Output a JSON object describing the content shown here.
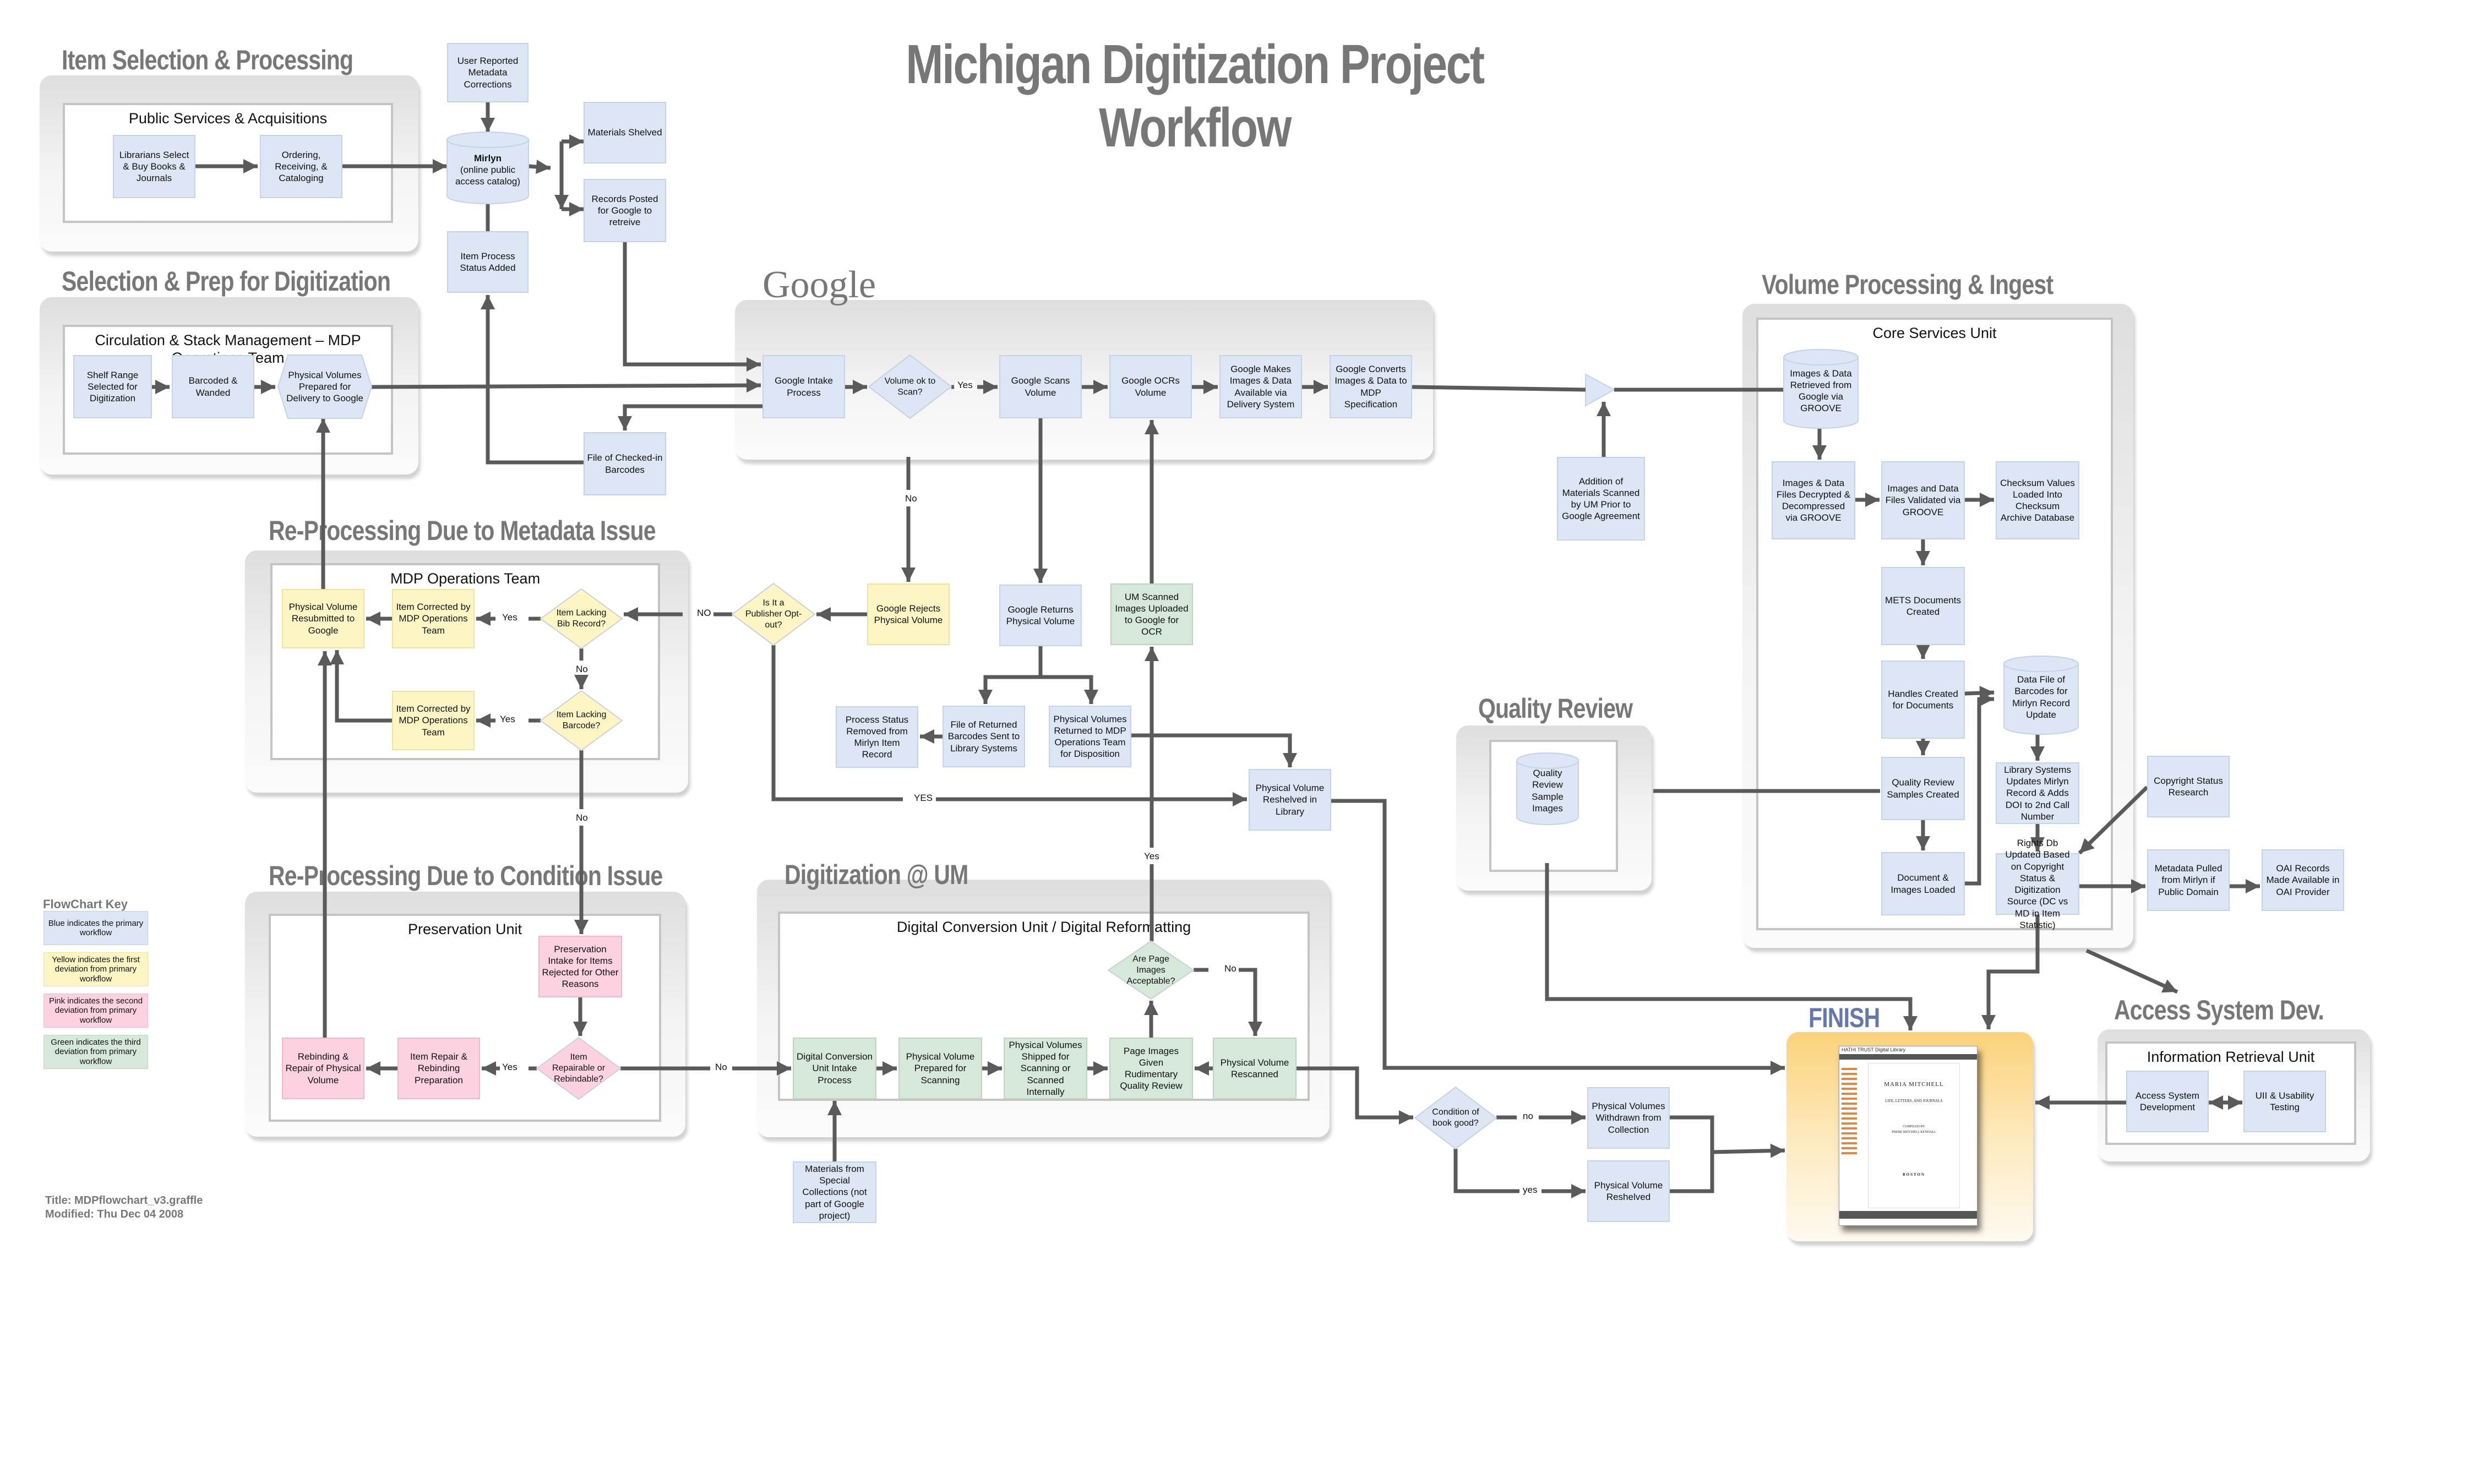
{
  "title": "Michigan Digitization Project Workflow",
  "colors": {
    "blue": "#dce6f4",
    "yellow": "#fdf6c4",
    "pink": "#fdd2e0",
    "green": "#d6e8da",
    "finish_title": "#6677aa",
    "connector": "#5a5a5a",
    "heading_gray": "#777777"
  },
  "panels": {
    "item_selection": {
      "title": "Item Selection & Processing",
      "unit": "Public Services & Acquisitions"
    },
    "selection_prep": {
      "title": "Selection & Prep for Digitization",
      "unit": "Circulation & Stack Management – MDP Operations Team"
    },
    "google": {
      "title": "Google"
    },
    "volume_processing": {
      "title": "Volume Processing & Ingest",
      "unit": "Core Services Unit"
    },
    "reprocessing_metadata": {
      "title": "Re-Processing Due to Metadata Issue",
      "unit": "MDP Operations Team"
    },
    "quality_review": {
      "title": "Quality Review"
    },
    "reprocessing_condition": {
      "title": "Re-Processing Due to Condition Issue",
      "unit": "Preservation Unit"
    },
    "digitization_um": {
      "title": "Digitization @ UM",
      "unit": "Digital Conversion Unit / Digital Reformatting"
    },
    "finish": {
      "title": "FINISH"
    },
    "access_system": {
      "title": "Access System Dev.",
      "unit": "Information Retrieval Unit"
    }
  },
  "nodes": {
    "user_reported": "User Reported Metadata Corrections",
    "mirlyn_name": "Mirlyn",
    "mirlyn_desc": "(online public access catalog)",
    "materials_shelved": "Materials Shelved",
    "records_posted": "Records Posted for Google to retreive",
    "item_process_status": "Item Process Status Added",
    "librarians_select": "Librarians Select & Buy Books & Journals",
    "ordering": "Ordering, Receiving, & Cataloging",
    "shelf_range": "Shelf Range Selected for Digitization",
    "barcoded": "Barcoded & Wanded",
    "physical_prepared": "Physical Volumes Prepared for Delivery to Google",
    "file_checked_in": "File of Checked-in Barcodes",
    "google_intake": "Google Intake Process",
    "volume_ok": "Volume ok to Scan?",
    "google_scans": "Google Scans Volume",
    "google_ocrs": "Google OCRs Volume",
    "google_makes": "Google Makes Images & Data Available via Delivery System",
    "google_converts": "Google Converts Images & Data to MDP Specification",
    "addition_materials": "Addition of Materials Scanned by UM Prior to Google Agreement",
    "images_retrieved": "Images & Data Retrieved from Google via GROOVE",
    "images_decrypted": "Images & Data Files Decrypted & Decompressed via GROOVE",
    "images_validated": "Images and Data Files Validated via GROOVE",
    "checksum": "Checksum Values Loaded Into Checksum Archive Database",
    "mets": "METS Documents Created",
    "handles": "Handles Created for Documents",
    "data_file_barcodes": "Data File of Barcodes for Mirlyn Record Update",
    "qr_samples": "Quality Review Samples Created",
    "library_systems": "Library Systems Updates Mirlyn Record & Adds DOI to 2nd Call Number",
    "document_loaded": "Document & Images Loaded",
    "rights_db": "Rights Db Updated Based on Copyright Status & Digitization Source (DC vs MD in Item Statistic)",
    "copyright_research": "Copyright  Status Research",
    "metadata_pulled": "Metadata Pulled from Mirlyn if Public Domain",
    "oai_records": "OAI Records Made Available in OAI Provider",
    "physical_resubmitted": "Physical Volume Resubmitted to Google",
    "item_corrected_1": "Item Corrected by MDP Operations Team",
    "item_lacking_bib": "Item Lacking Bib Record?",
    "item_corrected_2": "Item Corrected by MDP Operations Team",
    "item_lacking_barcode": "Item Lacking Barcode?",
    "publisher_optout": "Is It a Publisher Opt-out?",
    "google_rejects": "Google Rejects Physical Volume",
    "google_returns": "Google Returns Physical Volume",
    "um_scanned": "UM Scanned Images Uploaded to Google for OCR",
    "process_status_removed": "Process Status Removed from Mirlyn Item Record",
    "file_returned": "File of Returned Barcodes Sent to Library Systems",
    "physical_returned_mdp": "Physical Volumes Returned to MDP Operations Team for Disposition",
    "physical_reshelved_library": "Physical Volume Reshelved in Library",
    "qr_sample_images": "Quality Review Sample Images",
    "preservation_intake": "Preservation Intake for Items Rejected for Other Reasons",
    "rebinding": "Rebinding & Repair of Physical Volume",
    "item_repair": "Item Repair & Rebinding Preparation",
    "item_repairable": "Item Repairable or Rebindable?",
    "dcu_intake": "Digital Conversion Unit Intake Process",
    "physical_prepared_scanning": "Physical Volume Prepared for Scanning",
    "physical_shipped": "Physical Volumes Shipped for Scanning or Scanned Internally",
    "page_images_review": "Page Images Given Rudimentary Quality Review",
    "physical_rescanned": "Physical Volume Rescanned",
    "page_images_acceptable": "Are Page Images Acceptable?",
    "special_collections": "Materials from Special Collections (not part of Google project)",
    "condition_good": "Condition of book good?",
    "withdrawn": "Physical Volumes Withdrawn from Collection",
    "physical_reshelved": "Physical Volume Reshelved",
    "access_dev": "Access System Development",
    "uii_testing": "UII & Usability Testing"
  },
  "edge_labels": {
    "yes": "Yes",
    "no": "No",
    "NO": "NO",
    "YES": "YES",
    "yes_lower": "yes",
    "no_lower": "no"
  },
  "finish_screenshot": {
    "site": "HATHI TRUST Digital Library",
    "book_title": "MARIA MITCHELL",
    "subtitle": "LIFE, LETTERS, AND JOURNALS",
    "compiled": "COMPILED BY",
    "author": "PHEBE MITCHELL KENDALL",
    "place": "BOSTON"
  },
  "key": {
    "title": "FlowChart Key",
    "items": [
      {
        "text": "Blue indicates the primary workflow",
        "color": "blue"
      },
      {
        "text": "Yellow indicates the first deviation from primary workflow",
        "color": "yellow"
      },
      {
        "text": "Pink indicates the second deviation from primary workflow",
        "color": "pink"
      },
      {
        "text": "Green indicates the third deviation from primary workflow",
        "color": "green"
      }
    ]
  },
  "meta": {
    "title_line": "Title: MDPflowchart_v3.graffle",
    "modified_line": "Modified: Thu Dec 04 2008"
  }
}
